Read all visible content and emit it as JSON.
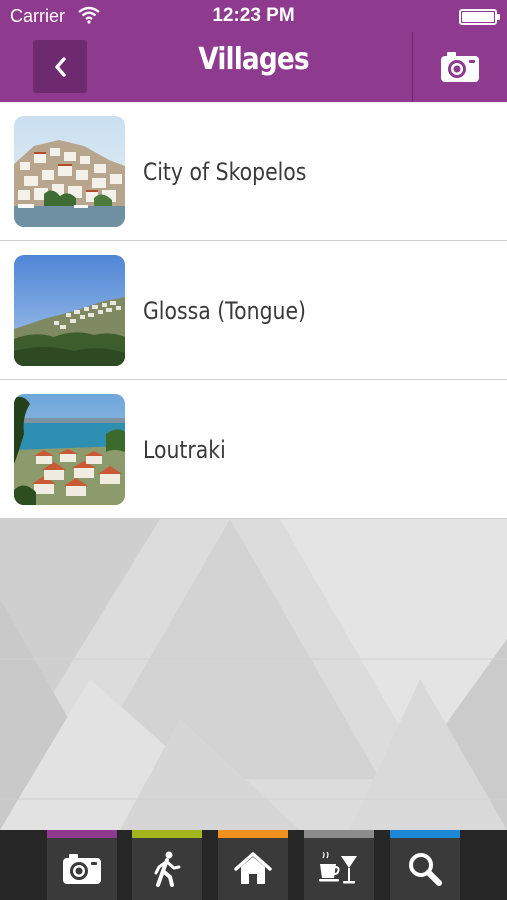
{
  "status_bar": {
    "carrier": "Carrier",
    "time": "12:23 PM"
  },
  "header": {
    "title": "Villages",
    "back_icon": "chevron-left-icon",
    "action_icon": "camera-icon"
  },
  "villages": [
    {
      "name": "City of Skopelos",
      "thumbnail": "town-harbor-photo"
    },
    {
      "name": "Glossa (Tongue)",
      "thumbnail": "hillside-village-photo"
    },
    {
      "name": "Loutraki",
      "thumbnail": "coastal-rooftops-photo"
    }
  ],
  "tabs": [
    {
      "icon": "camera-icon",
      "accent": "#8e3a8e"
    },
    {
      "icon": "hiker-icon",
      "accent": "#a3b51c"
    },
    {
      "icon": "home-icon",
      "accent": "#f0901e"
    },
    {
      "icon": "cafe-bar-icon",
      "accent": "#8c8c8c"
    },
    {
      "icon": "search-icon",
      "accent": "#1e88d6"
    }
  ],
  "colors": {
    "header": "#8e3a8e",
    "tabbar": "#262626"
  }
}
